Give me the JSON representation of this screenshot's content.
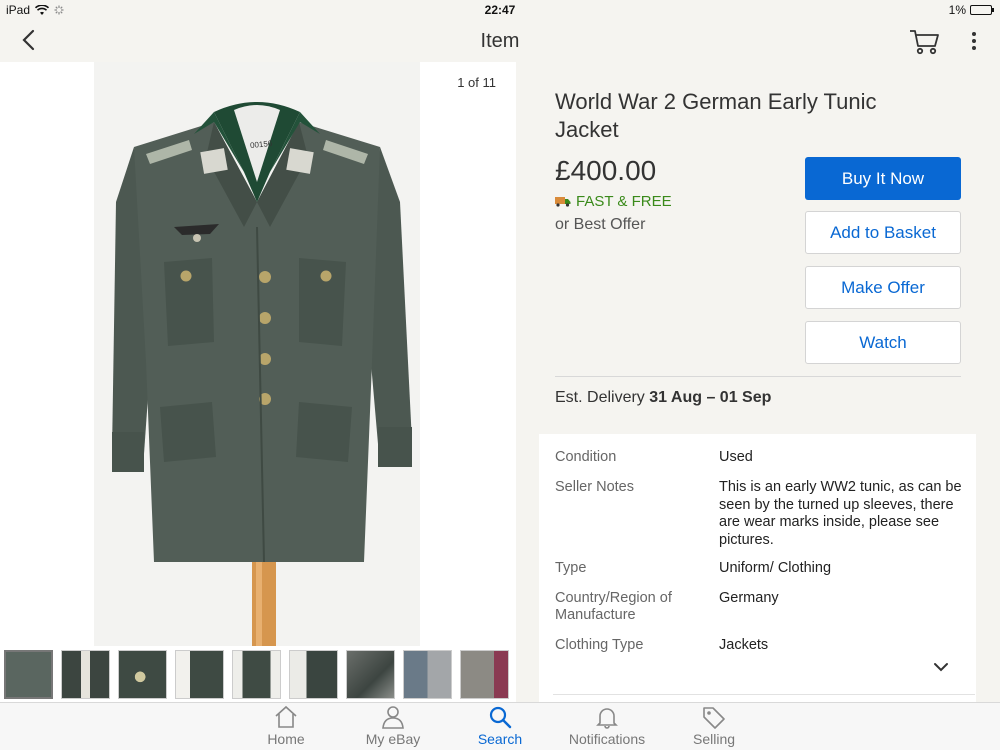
{
  "status_bar": {
    "device": "iPad",
    "time": "22:47",
    "battery": "1%"
  },
  "nav": {
    "title": "Item"
  },
  "gallery": {
    "counter": "1 of 11",
    "thumbnail_count": 9,
    "photo_label": "00156"
  },
  "item": {
    "title": "World War 2 German Early Tunic Jacket",
    "price": "£400.00",
    "shipping": "FAST & FREE",
    "best_offer": "or Best Offer"
  },
  "buttons": {
    "buy_now": "Buy It Now",
    "add_to_basket": "Add to Basket",
    "make_offer": "Make Offer",
    "watch": "Watch"
  },
  "delivery": {
    "label": "Est. Delivery",
    "dates": "31 Aug – 01 Sep"
  },
  "specifics": [
    {
      "key": "Condition",
      "value": "Used"
    },
    {
      "key": "Seller Notes",
      "value": "This is an early WW2 tunic, as can be seen by the turned up sleeves, there are wear marks inside, please see pictures."
    },
    {
      "key": "Type",
      "value": "Uniform/ Clothing"
    },
    {
      "key": "Country/Region of Manufacture",
      "value": "Germany"
    },
    {
      "key": "Clothing Type",
      "value": "Jackets"
    }
  ],
  "tabs": [
    {
      "label": "Home",
      "icon": "home-icon"
    },
    {
      "label": "My eBay",
      "icon": "person-icon"
    },
    {
      "label": "Search",
      "icon": "search-icon"
    },
    {
      "label": "Notifications",
      "icon": "bell-icon"
    },
    {
      "label": "Selling",
      "icon": "tag-icon"
    }
  ],
  "colors": {
    "accent": "#0968d3",
    "shipping_green": "#3a8a1a",
    "tunic": "#4e5a53",
    "collar": "#24503a"
  }
}
